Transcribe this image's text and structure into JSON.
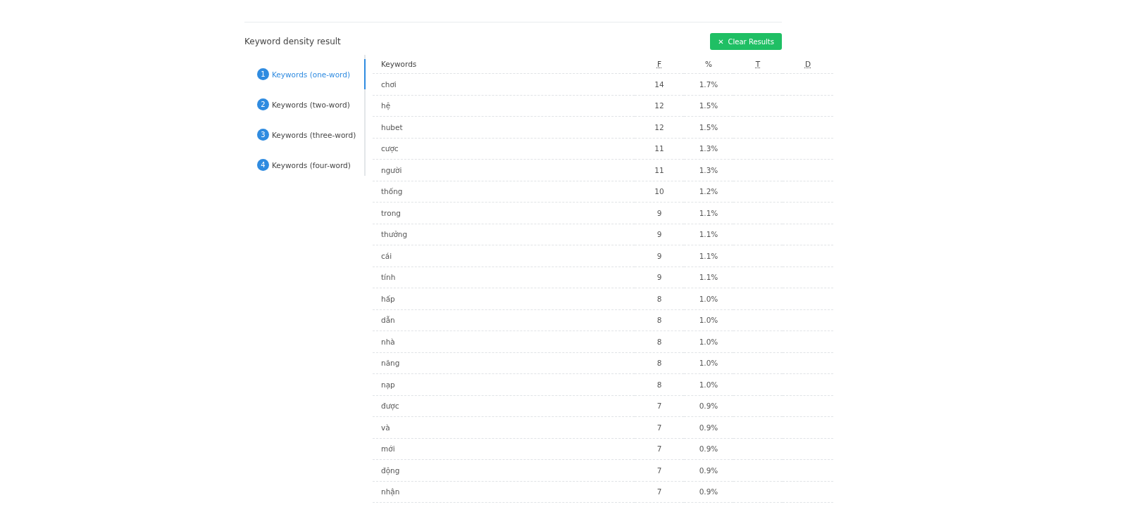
{
  "title": "Keyword density result",
  "clear_button": {
    "icon": "✕",
    "label": "Clear Results"
  },
  "tabs": [
    {
      "number": "1",
      "label": "Keywords (one-word)",
      "selected": true
    },
    {
      "number": "2",
      "label": "Keywords (two-word)",
      "selected": false
    },
    {
      "number": "3",
      "label": "Keywords (three-word)",
      "selected": false
    },
    {
      "number": "4",
      "label": "Keywords (four-word)",
      "selected": false
    }
  ],
  "table": {
    "columns": [
      {
        "label": "Keywords",
        "abbr": false
      },
      {
        "label": "F",
        "abbr": true
      },
      {
        "label": "%",
        "abbr": false
      },
      {
        "label": "T",
        "abbr": true
      },
      {
        "label": "D",
        "abbr": true
      }
    ],
    "rows": [
      [
        "chơi",
        "14",
        "1.7%"
      ],
      [
        "hệ",
        "12",
        "1.5%"
      ],
      [
        "hubet",
        "12",
        "1.5%"
      ],
      [
        "cược",
        "11",
        "1.3%"
      ],
      [
        "người",
        "11",
        "1.3%"
      ],
      [
        "thống",
        "10",
        "1.2%"
      ],
      [
        "trong",
        "9",
        "1.1%"
      ],
      [
        "thưởng",
        "9",
        "1.1%"
      ],
      [
        "cái",
        "9",
        "1.1%"
      ],
      [
        "tính",
        "9",
        "1.1%"
      ],
      [
        "hấp",
        "8",
        "1.0%"
      ],
      [
        "dẫn",
        "8",
        "1.0%"
      ],
      [
        "nhà",
        "8",
        "1.0%"
      ],
      [
        "năng",
        "8",
        "1.0%"
      ],
      [
        "nạp",
        "8",
        "1.0%"
      ],
      [
        "được",
        "7",
        "0.9%"
      ],
      [
        "và",
        "7",
        "0.9%"
      ],
      [
        "mới",
        "7",
        "0.9%"
      ],
      [
        "động",
        "7",
        "0.9%"
      ],
      [
        "nhận",
        "7",
        "0.9%"
      ]
    ]
  }
}
